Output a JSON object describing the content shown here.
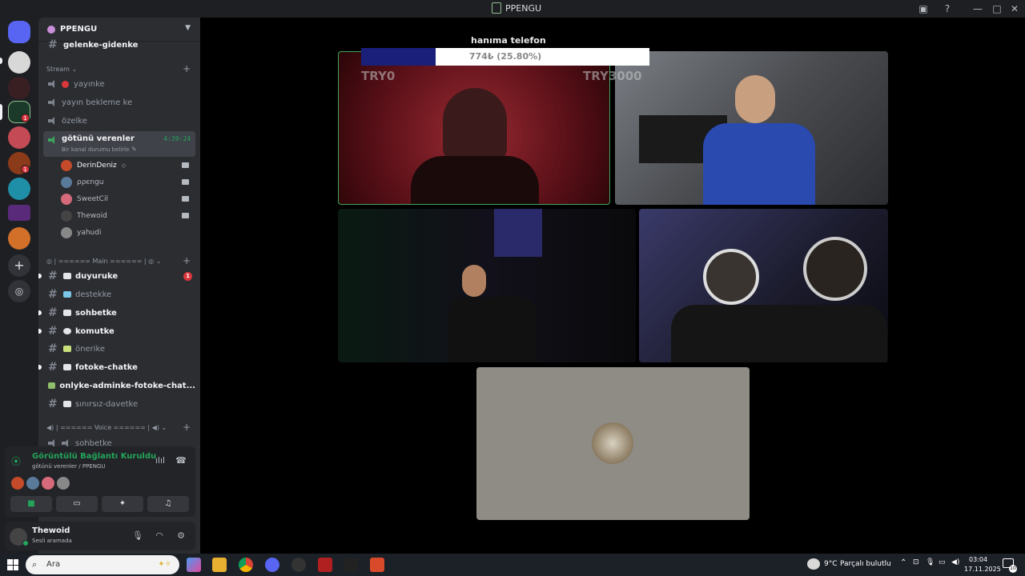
{
  "window": {
    "title": "PPENGU"
  },
  "guild": {
    "name": "PPENGU"
  },
  "channels": {
    "top_channel": "gelenke-gidenke",
    "stream_category": "Stream",
    "voice_channels": [
      "yayınke",
      "yayın bekleme ke",
      "özelke"
    ],
    "active_voice": {
      "name": "götünü verenler",
      "timer": "4:39:24",
      "status": "Bir kanal durumu belirle"
    },
    "members": [
      "DerinDeniz",
      "ρρєngu",
      "SweetCil",
      "Thewoid",
      "yahudi"
    ],
    "main_category": "| ====== Main ====== |",
    "text_channels": [
      {
        "name": "duyuruke",
        "badge": "1"
      },
      {
        "name": "destekke"
      },
      {
        "name": "sohbetke"
      },
      {
        "name": "komutke"
      },
      {
        "name": "önerike"
      },
      {
        "name": "fotoke-chatke"
      },
      {
        "name": "onlyke-adminke-fotoke-chat..."
      },
      {
        "name": "sınırsız-davetke"
      }
    ],
    "voice_category": "| ====== Voice ====== |",
    "voice_last": "sohbetke"
  },
  "connection": {
    "status": "Görüntülü Bağlantı Kuruldu",
    "location": "götünü verenler / PPENGU"
  },
  "user": {
    "name": "Thewoid",
    "status": "Sesli aramada"
  },
  "stage": {
    "overlay_title": "hanıma telefon",
    "progress_text": "774₺ (25.80%)",
    "progress_fraction": 0.258,
    "goal_start": "TRY0",
    "goal_end": "TRY3000"
  },
  "taskbar": {
    "search_placeholder": "Ara",
    "weather": "9°C",
    "weather_text": "Parçalı bulutlu",
    "time": "03:04",
    "date": "17.11.2025",
    "notif_count": "10"
  },
  "colors": {
    "accent_green": "#23a55a",
    "badge_red": "#da373c",
    "progress_fill": "#1a1f7a"
  }
}
